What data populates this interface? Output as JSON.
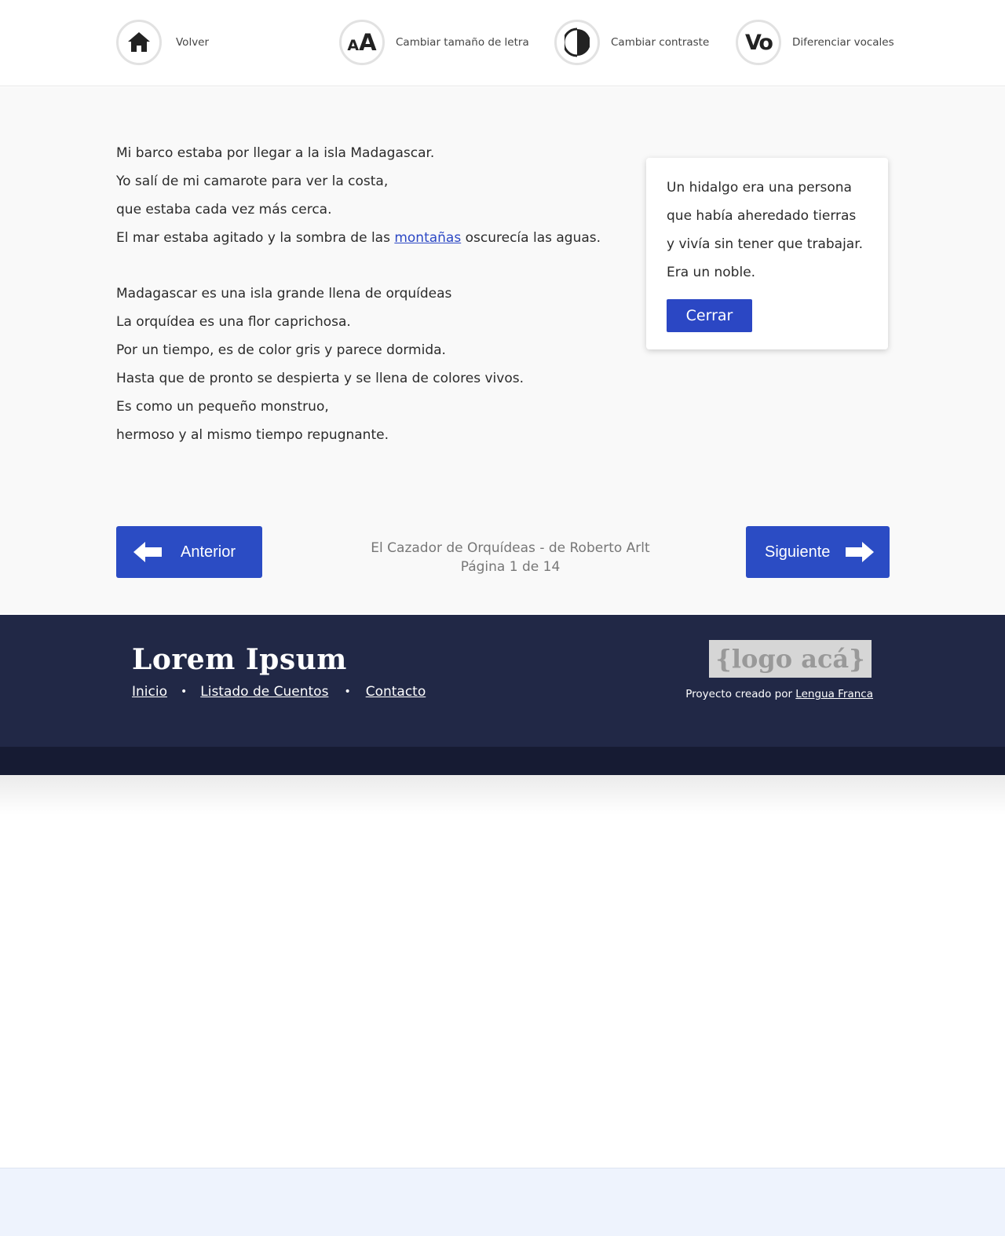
{
  "toolbar": {
    "home_label": "Volver",
    "font_size_label": "Cambiar tamaño de letra",
    "font_size_glyph_small": "A",
    "font_size_glyph_big": "A",
    "contrast_label": "Cambiar contraste",
    "vowels_label": "Diferenciar vocales",
    "vowels_glyph": "Vo",
    "icons": [
      "home-icon",
      "font-size-icon",
      "contrast-icon",
      "vowels-icon"
    ]
  },
  "poem": {
    "stanza1": {
      "line1": "Mi barco estaba por llegar a la isla Madagascar.",
      "line2": "Yo salí de mi camarote para ver la costa,",
      "line3": "que estaba cada vez más cerca.",
      "line4_before": "El mar estaba agitado y la sombra de las ",
      "line4_link": "montañas",
      "line4_after": " oscurecía las aguas."
    },
    "stanza2": [
      "Madagascar es una isla grande llena de orquídeas",
      "La orquídea es una flor caprichosa.",
      "Por un tiempo, es de color gris y parece dormida.",
      "Hasta que de pronto se despierta y se llena de colores vivos.",
      "Es como un pequeño monstruo,",
      "hermoso y al mismo tiempo repugnante."
    ]
  },
  "popup": {
    "lines": [
      "Un hidalgo era una persona",
      "que había aheredado tierras",
      "y vivía sin tener que trabajar.",
      "Era un noble."
    ],
    "close_label": "Cerrar"
  },
  "pagination": {
    "prev_label": "Anterior",
    "next_label": "Siguiente",
    "book_title": "El Cazador de Orquídeas - de Roberto Arlt",
    "page_info": "Página 1 de 14",
    "current_page": 1,
    "total_pages": 14
  },
  "footer": {
    "site_title": "Lorem Ipsum",
    "nav": [
      "Inicio",
      "Listado de Cuentos",
      "Contacto"
    ],
    "separator": "•",
    "logo_text": "{logo acá}",
    "credit_prefix": "Proyecto creado por ",
    "credit_link": "Lengua Franca"
  },
  "colors": {
    "accent": "#2b4cc4",
    "footer": "#212846",
    "footer_bottom": "#161b33",
    "main_bg": "#f9f9f9",
    "page_bottom": "#eef3fd"
  }
}
